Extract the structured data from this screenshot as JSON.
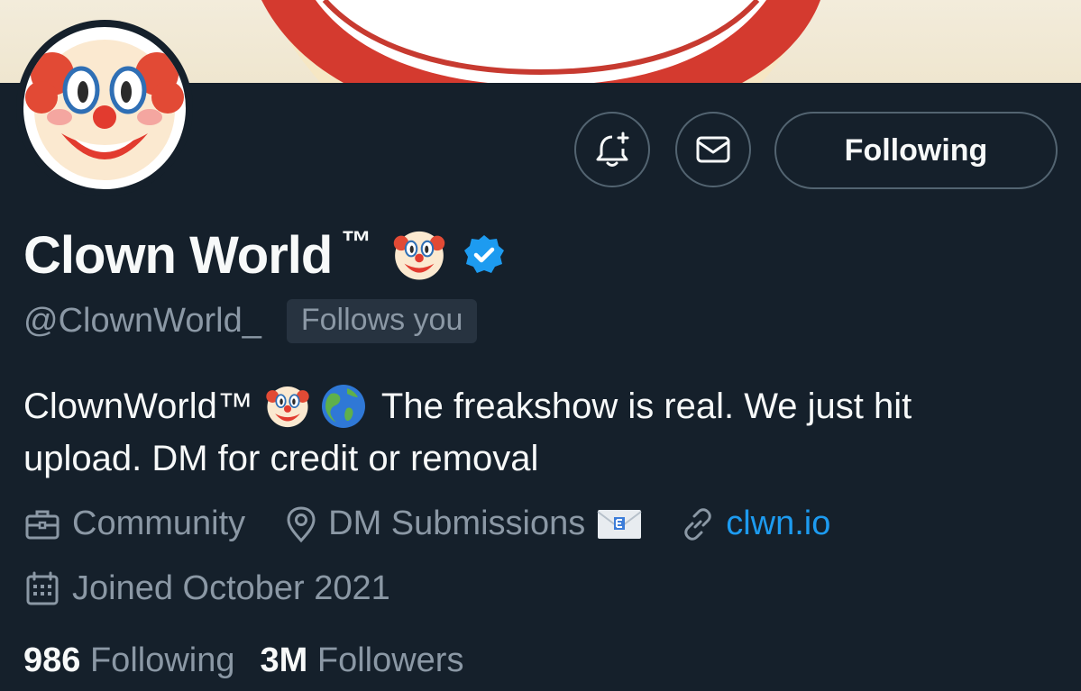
{
  "profile": {
    "name": "Clown World",
    "tm": "™",
    "handle": "@ClownWorld_",
    "follows_you": "Follows you",
    "bio_line1_a": "ClownWorld™",
    "bio_line1_b": "The freakshow is real. We just hit",
    "bio_line2": "upload. DM for credit or removal",
    "category": "Community",
    "location": "DM Submissions",
    "link": "clwn.io",
    "joined": "Joined October 2021",
    "following_count": "986",
    "following_label": "Following",
    "followers_count": "3M",
    "followers_label": "Followers"
  },
  "actions": {
    "follow_state_label": "Following"
  },
  "icons": {
    "notify": "bell-plus-icon",
    "message": "envelope-icon",
    "verified": "verified-badge-icon",
    "category": "briefcase-icon",
    "location": "location-pin-icon",
    "link": "link-icon",
    "calendar": "calendar-icon"
  },
  "colors": {
    "background": "#15202b",
    "accent": "#1d9bf0",
    "muted_text": "#8b98a5",
    "border": "#536471"
  }
}
